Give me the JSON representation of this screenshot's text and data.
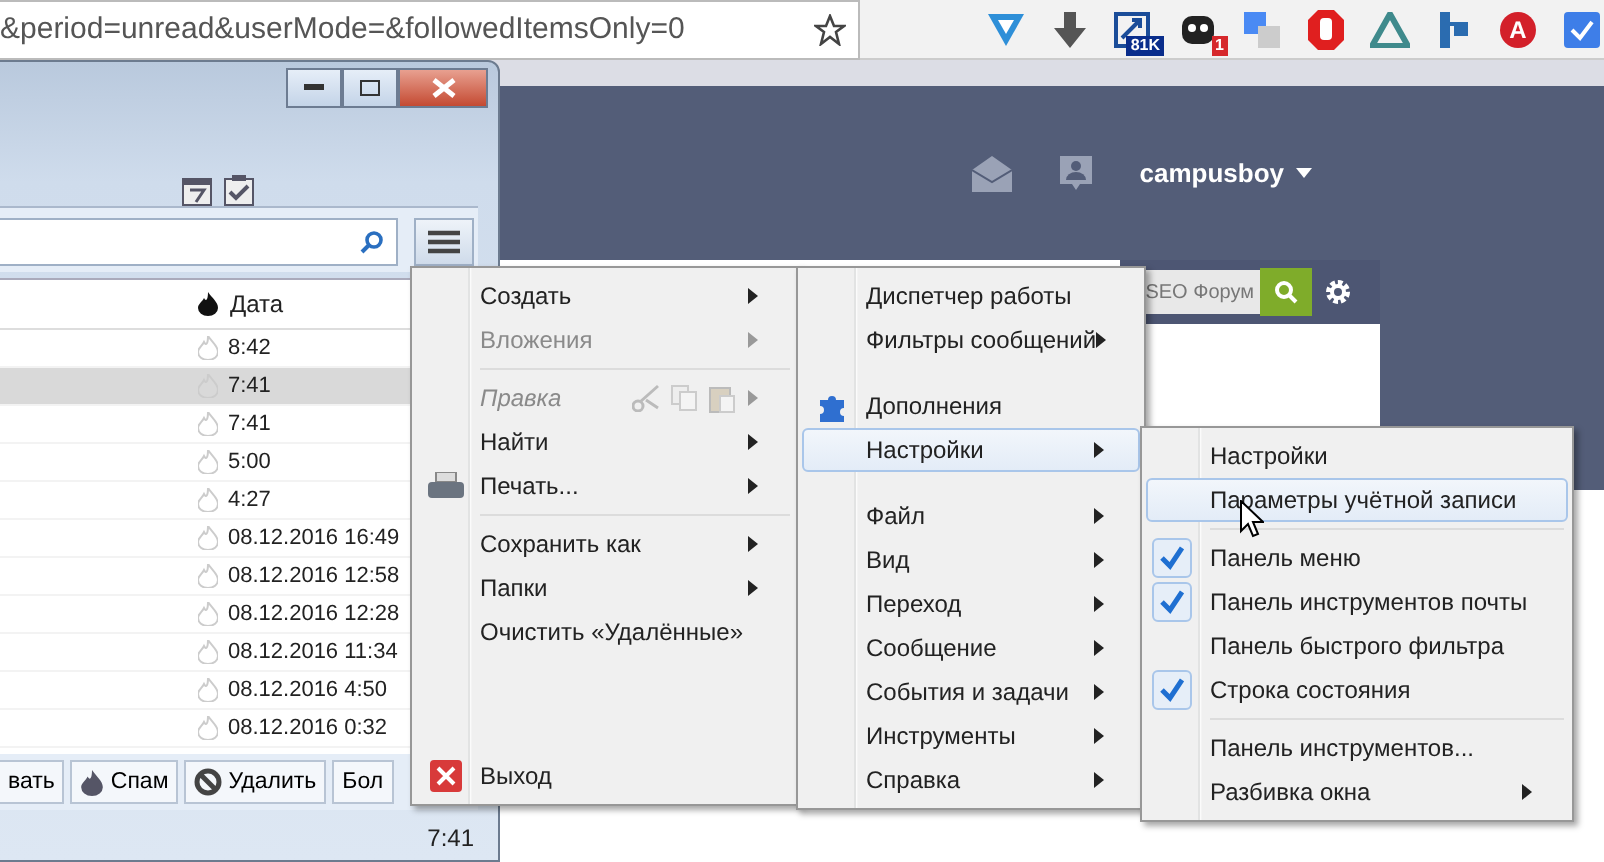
{
  "browser": {
    "url": "&period=unread&userMode=&followedItemsOnly=0",
    "extensions": [
      {
        "kind": "v"
      },
      {
        "kind": "download"
      },
      {
        "kind": "chart",
        "badge": "81K"
      },
      {
        "kind": "dark",
        "badge": "1"
      },
      {
        "kind": "translate"
      },
      {
        "kind": "stop"
      },
      {
        "kind": "triangle"
      },
      {
        "kind": "flag"
      },
      {
        "kind": "letter",
        "label": "A"
      },
      {
        "kind": "check"
      }
    ]
  },
  "site": {
    "username": "campusboy",
    "search": {
      "placeholder": "SEO Форум"
    }
  },
  "mail_window": {
    "column_header": "Дата",
    "rows": [
      {
        "date": "8:42",
        "selected": false
      },
      {
        "date": "7:41",
        "selected": true
      },
      {
        "date": "7:41",
        "selected": false
      },
      {
        "date": "5:00",
        "selected": false
      },
      {
        "date": "4:27",
        "selected": false
      },
      {
        "date": "08.12.2016 16:49",
        "selected": false
      },
      {
        "date": "08.12.2016 12:58",
        "selected": false
      },
      {
        "date": "08.12.2016 12:28",
        "selected": false
      },
      {
        "date": "08.12.2016 11:34",
        "selected": false
      },
      {
        "date": "08.12.2016 4:50",
        "selected": false
      },
      {
        "date": "08.12.2016 0:32",
        "selected": false
      }
    ],
    "buttons": [
      "вать",
      "Спам",
      "Удалить",
      "Бол"
    ],
    "status": "7:41"
  },
  "app_menu": [
    {
      "kind": "item",
      "label": "Создать",
      "disabled": false,
      "submenu": true
    },
    {
      "kind": "item",
      "label": "Вложения",
      "disabled": true,
      "submenu": true
    },
    {
      "kind": "separator"
    },
    {
      "kind": "edit",
      "label": "Правка",
      "disabled": true,
      "submenu": true
    },
    {
      "kind": "item",
      "label": "Найти",
      "disabled": false,
      "submenu": true
    },
    {
      "kind": "print",
      "label": "Печать...",
      "disabled": false,
      "submenu": true
    },
    {
      "kind": "separator"
    },
    {
      "kind": "item",
      "label": "Сохранить как",
      "disabled": false,
      "submenu": true
    },
    {
      "kind": "item",
      "label": "Папки",
      "disabled": false,
      "submenu": true
    },
    {
      "kind": "item",
      "label": "Очистить «Удалённые»",
      "disabled": false,
      "submenu": false
    },
    {
      "kind": "spacer"
    },
    {
      "kind": "exit",
      "label": "Выход",
      "disabled": false,
      "submenu": false
    }
  ],
  "tools_menu": [
    {
      "kind": "item",
      "label": "Диспетчер работы",
      "submenu": false,
      "selected": false
    },
    {
      "kind": "item",
      "label": "Фильтры сообщений",
      "submenu": true,
      "selected": false
    },
    {
      "kind": "gap"
    },
    {
      "kind": "addon",
      "label": "Дополнения",
      "submenu": false,
      "selected": false
    },
    {
      "kind": "item",
      "label": "Настройки",
      "submenu": true,
      "selected": true
    },
    {
      "kind": "gap"
    },
    {
      "kind": "item",
      "label": "Файл",
      "submenu": true,
      "selected": false
    },
    {
      "kind": "item",
      "label": "Вид",
      "submenu": true,
      "selected": false
    },
    {
      "kind": "item",
      "label": "Переход",
      "submenu": true,
      "selected": false
    },
    {
      "kind": "item",
      "label": "Сообщение",
      "submenu": true,
      "selected": false
    },
    {
      "kind": "item",
      "label": "События и задачи",
      "submenu": true,
      "selected": false
    },
    {
      "kind": "item",
      "label": "Инструменты",
      "submenu": true,
      "selected": false
    },
    {
      "kind": "item",
      "label": "Справка",
      "submenu": true,
      "selected": false
    }
  ],
  "settings_menu": [
    {
      "kind": "item",
      "label": "Настройки",
      "submenu": false,
      "selected": false
    },
    {
      "kind": "item",
      "label": "Параметры учётной записи",
      "submenu": false,
      "selected": true
    },
    {
      "kind": "separator"
    },
    {
      "kind": "check",
      "label": "Панель меню",
      "checked": true
    },
    {
      "kind": "check",
      "label": "Панель инструментов почты",
      "checked": true
    },
    {
      "kind": "check",
      "label": "Панель быстрого фильтра",
      "checked": false
    },
    {
      "kind": "check",
      "label": "Строка состояния",
      "checked": true
    },
    {
      "kind": "separator"
    },
    {
      "kind": "item",
      "label": "Панель инструментов...",
      "submenu": false,
      "selected": false
    },
    {
      "kind": "item",
      "label": "Разбивка окна",
      "submenu": true,
      "selected": false
    }
  ]
}
